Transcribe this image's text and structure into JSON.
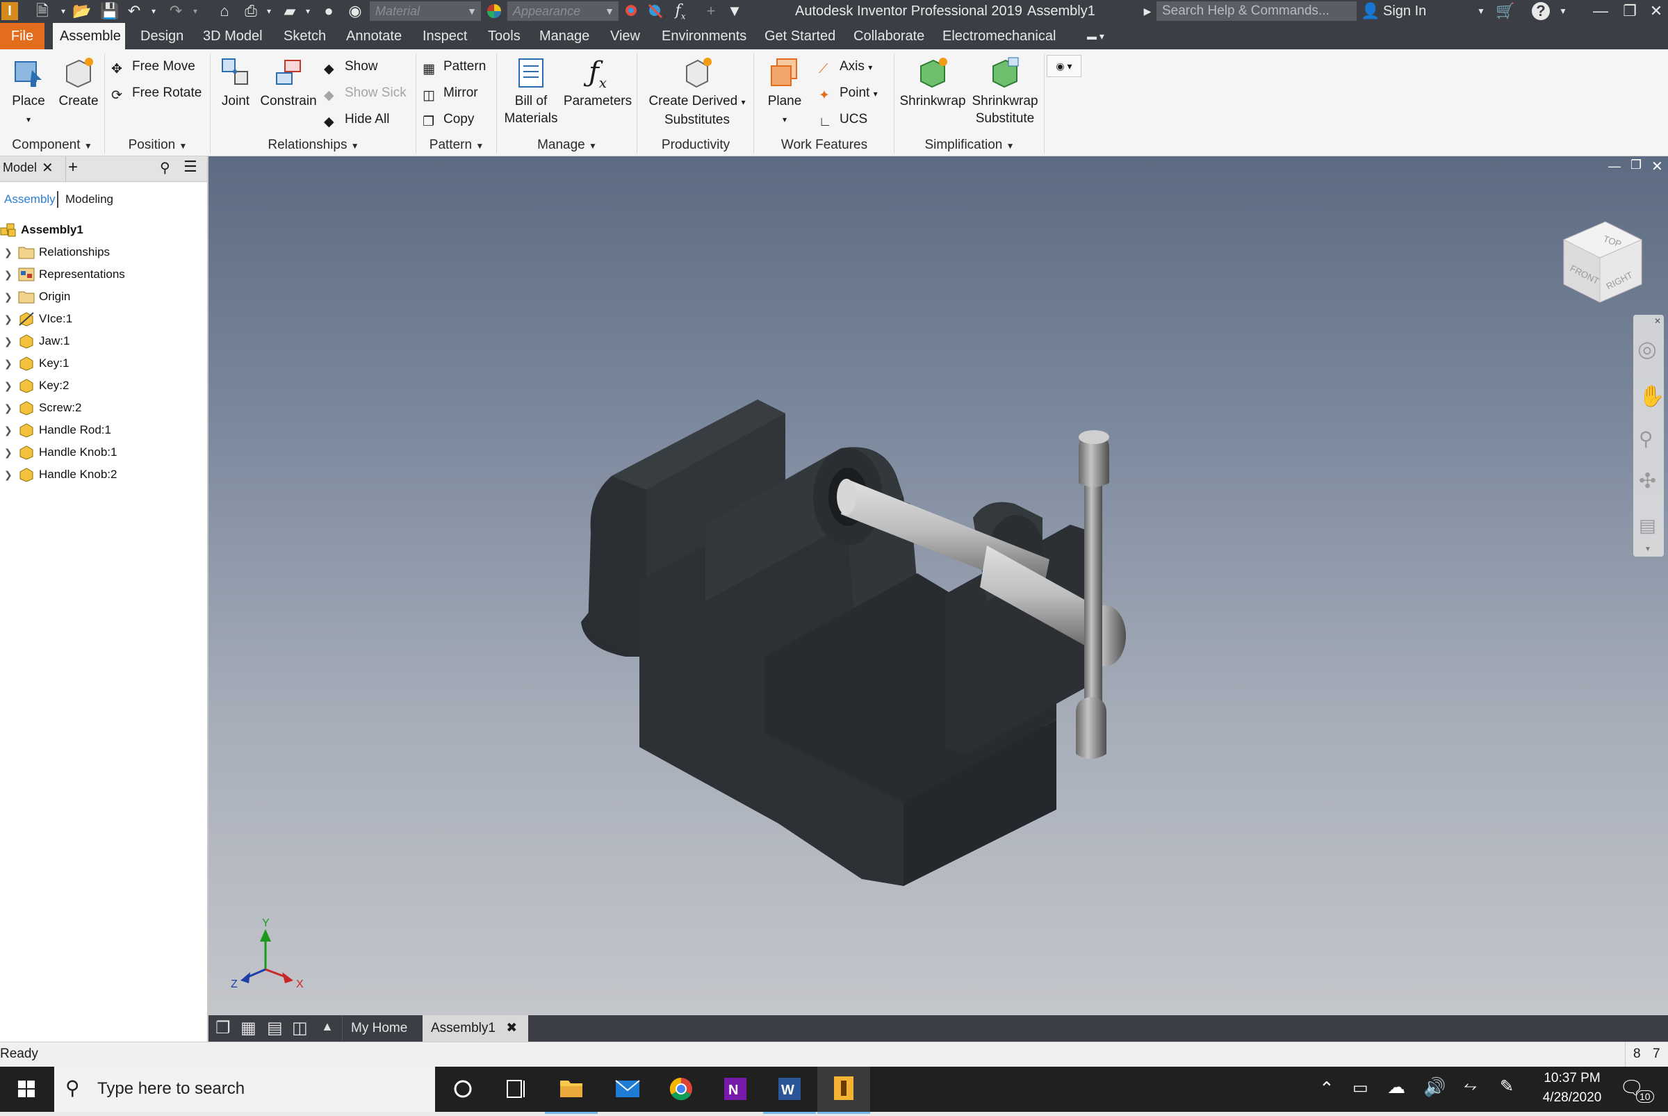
{
  "app": {
    "title": "Autodesk Inventor Professional 2019",
    "document": "Assembly1",
    "search_placeholder": "Search Help & Commands...",
    "sign_in": "Sign In",
    "material_combo": "Material",
    "appearance_combo": "Appearance",
    "fx_label": "f"
  },
  "tabs": [
    {
      "label": "File"
    },
    {
      "label": "Assemble"
    },
    {
      "label": "Design"
    },
    {
      "label": "3D Model"
    },
    {
      "label": "Sketch"
    },
    {
      "label": "Annotate"
    },
    {
      "label": "Inspect"
    },
    {
      "label": "Tools"
    },
    {
      "label": "Manage"
    },
    {
      "label": "View"
    },
    {
      "label": "Environments"
    },
    {
      "label": "Get Started"
    },
    {
      "label": "Collaborate"
    },
    {
      "label": "Electromechanical"
    }
  ],
  "ribbon": {
    "place": "Place",
    "create": "Create",
    "free_move": "Free Move",
    "free_rotate": "Free Rotate",
    "joint": "Joint",
    "constrain": "Constrain",
    "show": "Show",
    "show_sick": "Show Sick",
    "hide_all": "Hide All",
    "pattern": "Pattern",
    "mirror": "Mirror",
    "copy": "Copy",
    "bom_1": "Bill of",
    "bom_2": "Materials",
    "parameters": "Parameters",
    "cds_1": "Create Derived",
    "cds_2": "Substitutes",
    "plane": "Plane",
    "axis": "Axis",
    "point": "Point",
    "ucs": "UCS",
    "shrinkwrap": "Shrinkwrap",
    "shrinkwrap_sub_1": "Shrinkwrap",
    "shrinkwrap_sub_2": "Substitute",
    "panels": {
      "component": "Component",
      "position": "Position",
      "relationships": "Relationships",
      "pattern": "Pattern",
      "manage": "Manage",
      "productivity": "Productivity",
      "work_features": "Work Features",
      "simplification": "Simplification"
    }
  },
  "browser": {
    "tab": "Model",
    "mode_assembly": "Assembly",
    "mode_modeling": "Modeling",
    "root": "Assembly1",
    "items": [
      {
        "label": "Relationships",
        "icon": "folder-icon"
      },
      {
        "label": "Representations",
        "icon": "representations-icon"
      },
      {
        "label": "Origin",
        "icon": "folder-icon"
      },
      {
        "label": "VIce:1",
        "icon": "grounded-part-icon"
      },
      {
        "label": "Jaw:1",
        "icon": "part-icon"
      },
      {
        "label": "Key:1",
        "icon": "part-icon"
      },
      {
        "label": "Key:2",
        "icon": "part-icon"
      },
      {
        "label": "Screw:2",
        "icon": "part-icon"
      },
      {
        "label": "Handle Rod:1",
        "icon": "part-icon"
      },
      {
        "label": "Handle Knob:1",
        "icon": "part-icon"
      },
      {
        "label": "Handle Knob:2",
        "icon": "part-icon"
      }
    ]
  },
  "viewcube": {
    "top": "TOP",
    "front": "FRONT",
    "right": "RIGHT"
  },
  "triad": {
    "x": "X",
    "y": "Y",
    "z": "Z"
  },
  "doc_tabs": {
    "home": "My Home",
    "doc": "Assembly1"
  },
  "status": {
    "text": "Ready",
    "count_a": "8",
    "count_b": "7"
  },
  "taskbar": {
    "search_placeholder": "Type here to search",
    "time": "10:37 PM",
    "date": "4/28/2020",
    "notifications": "10"
  },
  "colors": {
    "accent_file": "#e26d1c",
    "titlebar": "#3b3f45",
    "model_body": "#2f3337",
    "steel": "#b8b8b8"
  }
}
